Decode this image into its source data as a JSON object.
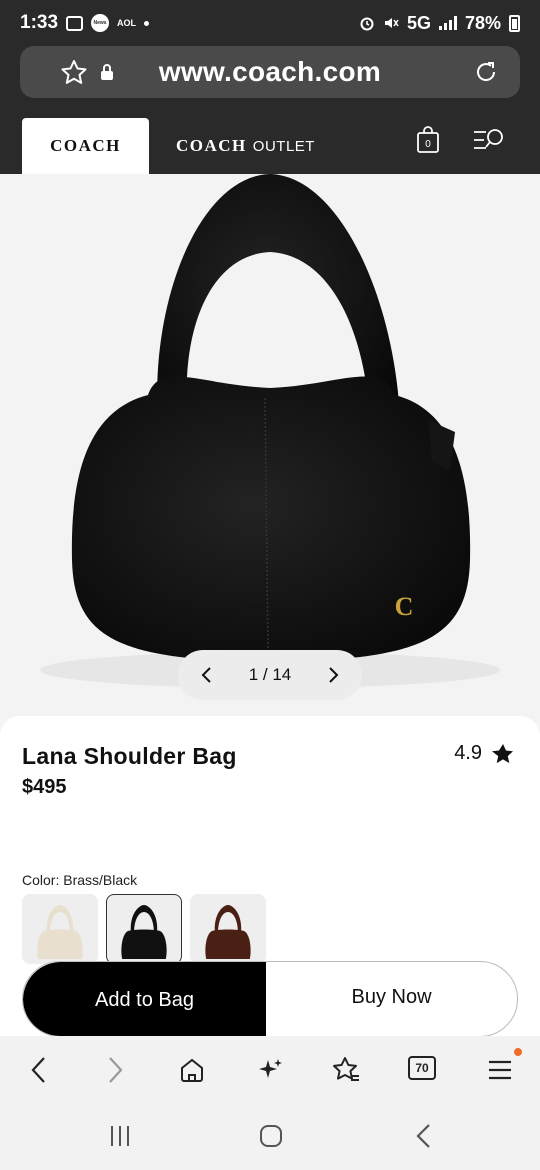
{
  "status_bar": {
    "time": "1:33",
    "news_label": "News",
    "aol_label": "AOL",
    "network": "5G",
    "battery": "78%"
  },
  "browser": {
    "url": "www.coach.com",
    "tab_count": "70"
  },
  "site_header": {
    "coach_tab": "COACH",
    "outlet_brand": "COACH",
    "outlet_word": "OUTLET",
    "bag_count": "0"
  },
  "gallery": {
    "position": "1 / 14"
  },
  "product": {
    "name": "Lana Shoulder Bag",
    "price": "$495",
    "rating": "4.9",
    "color_label": "Color: Brass/Black",
    "swatches": [
      {
        "name": "Chalk",
        "color": "#e8dfcf"
      },
      {
        "name": "Black",
        "color": "#111111",
        "selected": true
      },
      {
        "name": "Brown",
        "color": "#4a1f14"
      }
    ]
  },
  "actions": {
    "add_to_bag": "Add to Bag",
    "buy_now": "Buy Now"
  },
  "colors": {
    "header_bg": "#2a2a2a",
    "accent_notification": "#f06a2a",
    "primary_button": "#000000"
  }
}
